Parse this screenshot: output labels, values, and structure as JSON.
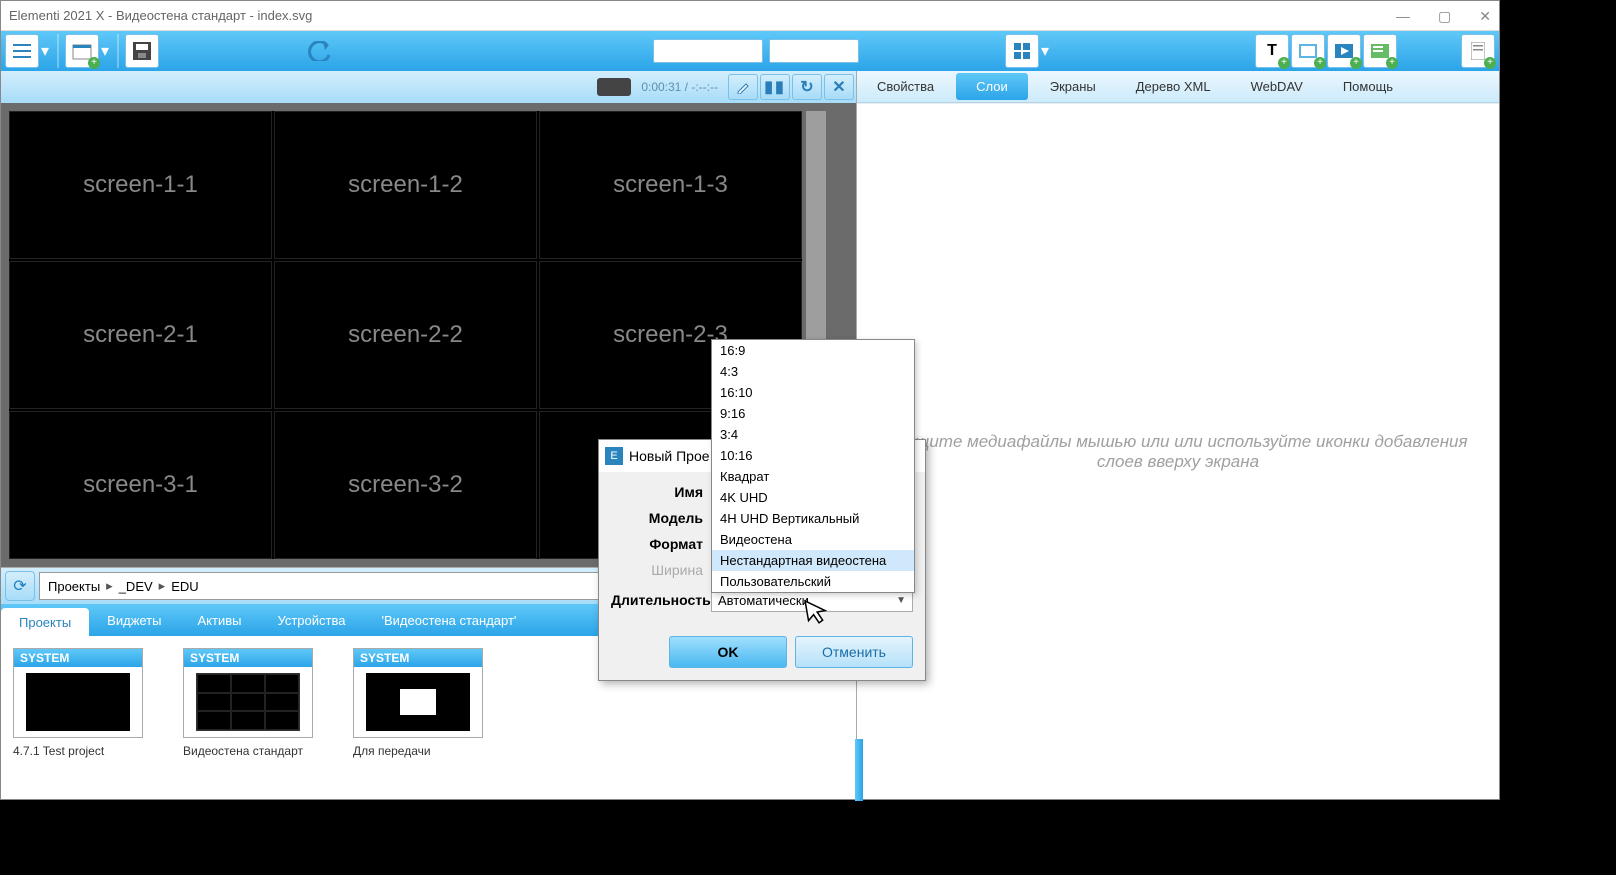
{
  "titlebar": "Elementi 2021 X - Видеостена стандарт - index.svg",
  "preview": {
    "time": "0:00:31 / -:--:--",
    "screens": [
      [
        "screen-1-1",
        "screen-1-2",
        "screen-1-3"
      ],
      [
        "screen-2-1",
        "screen-2-2",
        "screen-2-3"
      ],
      [
        "screen-3-1",
        "screen-3-2",
        ""
      ]
    ]
  },
  "right_tabs": [
    "Свойства",
    "Слои",
    "Экраны",
    "Дерево XML",
    "WebDAV",
    "Помощь"
  ],
  "right_hint": "…ащите медиафайлы мышью или ​или используйте иконки добавления слоев вверху экрана",
  "breadcrumb": [
    "Проекты",
    "_DEV",
    "EDU"
  ],
  "browser_tabs": [
    "Проекты",
    "Виджеты",
    "Активы",
    "Устройства",
    "'Видеостена стандарт'"
  ],
  "projects": [
    {
      "type": "SYSTEM",
      "label": "4.7.1 Test project",
      "kind": "black"
    },
    {
      "type": "SYSTEM",
      "label": "Видеостена стандарт",
      "kind": "grid"
    },
    {
      "type": "SYSTEM",
      "label": "Для передачи",
      "kind": "white"
    }
  ],
  "dialog": {
    "title": "Новый Прое",
    "rows": {
      "name_lbl": "Имя",
      "model_lbl": "Модель",
      "format_lbl": "Формат",
      "width_lbl": "Ширина",
      "duration_lbl": "Длительность",
      "duration_val": "Автоматически"
    },
    "ok": "OK",
    "cancel": "Отменить"
  },
  "dropdown": {
    "items": [
      "16:9",
      "4:3",
      "16:10",
      "9:16",
      "3:4",
      "10:16",
      "Квадрат",
      "4K UHD",
      "4H UHD Вертикальный",
      "Видеостена",
      "Нестандартная видеостена",
      "Пользовательский"
    ],
    "highlight": 10
  }
}
